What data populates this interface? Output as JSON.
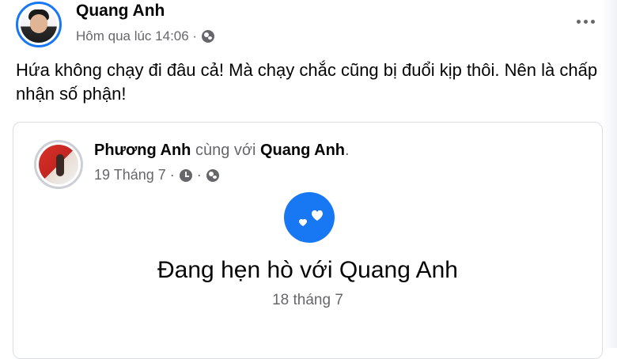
{
  "post": {
    "author": "Quang Anh",
    "timestamp": "Hôm qua lúc 14:06 ·",
    "privacy_icon": "globe-icon",
    "text": "Hứa không chạy đi đâu cả! Mà chạy chắc cũng bị đuổi kịp thôi. Nên là chấp nhận số phận!"
  },
  "shared_post": {
    "author": "Phương Anh",
    "with_text": "cùng với",
    "tagged": "Quang Anh",
    "tail": ".",
    "date": "19 Tháng 7 ·",
    "separator": "·"
  },
  "life_event": {
    "icon": "hearts-icon",
    "title": "Đang hẹn hò với Quang Anh",
    "date": "18 tháng 7"
  },
  "colors": {
    "accent": "#1877f2",
    "text": "#050505",
    "secondary": "#65676b",
    "border": "#dadde1"
  }
}
